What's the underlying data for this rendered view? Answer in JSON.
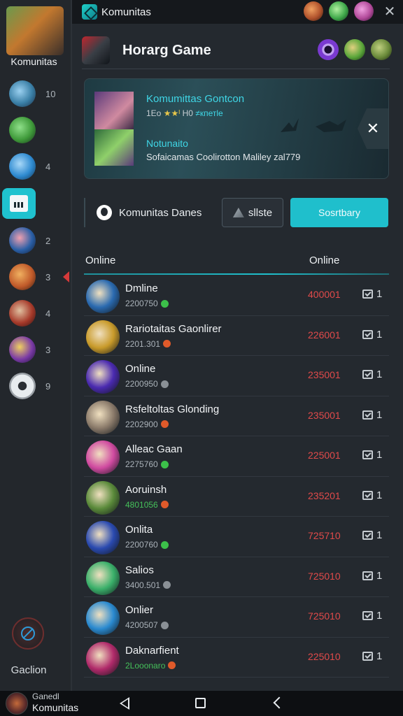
{
  "window": {
    "title": "Komunitas"
  },
  "top_avatars": [
    {
      "icon": "avatar-warrior-icon",
      "color": "#b0522c"
    },
    {
      "icon": "avatar-green-arrow-icon",
      "color": "#3fa84a"
    },
    {
      "icon": "avatar-mage-icon",
      "color": "#b24a9a"
    }
  ],
  "sidebar": {
    "app_label": "Komunitas",
    "items": [
      {
        "icon": "hero-avatar-icon",
        "badge": "10",
        "color": "#3a7fa6"
      },
      {
        "icon": "green-blade-icon",
        "badge": "",
        "color": "#3f9a3a"
      },
      {
        "icon": "ship-avatar-icon",
        "badge": "4",
        "color": "#2e8ad0"
      },
      {
        "icon": "document-icon",
        "badge": "",
        "color": "#1fc2cf"
      },
      {
        "icon": "fighter-avatar-icon",
        "badge": "2",
        "color": "#2a5fa6"
      },
      {
        "icon": "fire-warrior-icon",
        "badge": "3",
        "color": "#c05a2a"
      },
      {
        "icon": "mask-avatar-icon",
        "badge": "4",
        "color": "#a63a2a"
      },
      {
        "icon": "wizard-avatar-icon",
        "badge": "3",
        "color": "#7a3aa6"
      },
      {
        "icon": "camera-lens-icon",
        "badge": "9",
        "color": "#e8ecef"
      }
    ],
    "bottom_label": "Gaclion"
  },
  "game": {
    "title": "Horarg Game"
  },
  "header_avatars": [
    {
      "icon": "purple-ring-icon",
      "color": "#7a3ad0"
    },
    {
      "icon": "green-hero-icon",
      "color": "#5aa63a"
    },
    {
      "icon": "goblin-hero-icon",
      "color": "#6a8a3a"
    }
  ],
  "banner": {
    "title": "Komumittas Gontcon",
    "sub_prefix": "1Ео",
    "sub_stars": "★★ᴵ",
    "sub_mid": "H0",
    "sub_tag": "≠кпетle",
    "title2": "Notunaito",
    "desc": "Sofaicamas Coolirotton Maliley zal779",
    "close_label": "✕"
  },
  "filters": {
    "brand_label": "Komunitas Danes",
    "btn_label": "sllste",
    "primary_label": "Sosrtbary"
  },
  "list": {
    "header_left": "Online",
    "header_right": "Online",
    "rows": [
      {
        "name": "Dmline",
        "sub": "2200750",
        "sub_green": false,
        "dot": "#3cc04a",
        "score": "400001",
        "msgs": "1",
        "av": "#2a6ab0"
      },
      {
        "name": "Rariotaitas Gaonlirer",
        "sub": "2201.301",
        "sub_green": false,
        "dot": "#e05a2a",
        "score": "226001",
        "msgs": "1",
        "av": "#c89a2a"
      },
      {
        "name": "Online",
        "sub": "2200950",
        "sub_green": false,
        "dot": "#8a9096",
        "score": "235001",
        "msgs": "1",
        "av": "#4a2ab0"
      },
      {
        "name": "Rsfeltoltas Glonding",
        "sub": "2202900",
        "sub_green": false,
        "dot": "#e05a2a",
        "score": "235001",
        "msgs": "1",
        "av": "#8a7a6a"
      },
      {
        "name": "Alleac Gaan",
        "sub": "2275760",
        "sub_green": false,
        "dot": "#3cc04a",
        "score": "225001",
        "msgs": "1",
        "av": "#d04aa0"
      },
      {
        "name": "Aoruinsh",
        "sub": "4801056",
        "sub_green": true,
        "dot": "#e05a2a",
        "score": "235201",
        "msgs": "1",
        "av": "#5a8a3a"
      },
      {
        "name": "Onlita",
        "sub": "2200760",
        "sub_green": false,
        "dot": "#3cc04a",
        "score": "725710",
        "msgs": "1",
        "av": "#2a4ab0"
      },
      {
        "name": "Salios",
        "sub": "3400.501",
        "sub_green": false,
        "dot": "#8a9096",
        "score": "725010",
        "msgs": "1",
        "av": "#3ab06a"
      },
      {
        "name": "Onlier",
        "sub": "4200507",
        "sub_green": false,
        "dot": "#8a9096",
        "score": "725010",
        "msgs": "1",
        "av": "#2a8ad0"
      },
      {
        "name": "Daknarfient",
        "sub": "2Looonaro",
        "sub_green": true,
        "dot": "#e05a2a",
        "score": "225010",
        "msgs": "1",
        "av": "#b02a6a"
      }
    ]
  },
  "bottom": {
    "app_top": "Ganedl",
    "app_bottom": "Komunitas"
  }
}
